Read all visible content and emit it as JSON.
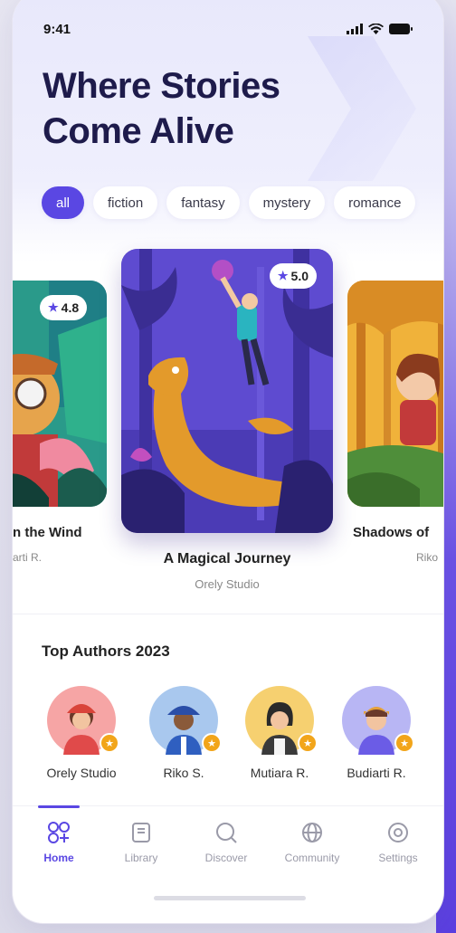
{
  "status": {
    "time": "9:41"
  },
  "headline": {
    "line1": "Where Stories",
    "line2": "Come Alive"
  },
  "categories": [
    "all",
    "fiction",
    "fantasy",
    "mystery",
    "romance"
  ],
  "books": [
    {
      "title": "n the Wind",
      "author": "arti R.",
      "rating": "4.8"
    },
    {
      "title": "A Magical Journey",
      "author": "Orely Studio",
      "rating": "5.0"
    },
    {
      "title": "Shadows of",
      "author": "Riko"
    }
  ],
  "top_authors": {
    "title": "Top Authors 2023",
    "authors": [
      {
        "name": "Orely Studio"
      },
      {
        "name": "Riko S."
      },
      {
        "name": "Mutiara R."
      },
      {
        "name": "Budiarti R."
      }
    ]
  },
  "tabs": [
    {
      "label": "Home",
      "icon": "home-icon"
    },
    {
      "label": "Library",
      "icon": "library-icon"
    },
    {
      "label": "Discover",
      "icon": "discover-icon"
    },
    {
      "label": "Community",
      "icon": "community-icon"
    },
    {
      "label": "Settings",
      "icon": "settings-icon"
    }
  ],
  "colors": {
    "accent": "#5a47e3",
    "headline": "#1e1b4b",
    "badge": "#f2a51a"
  }
}
